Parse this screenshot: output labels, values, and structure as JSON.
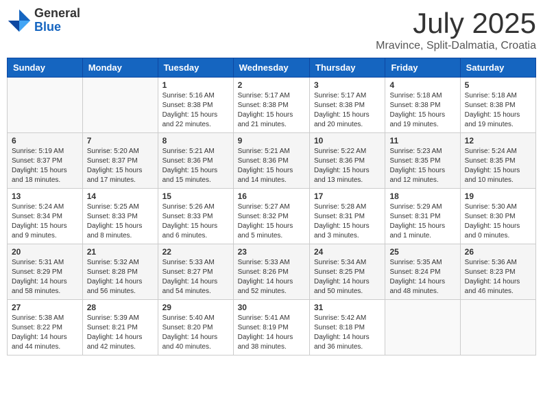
{
  "header": {
    "logo_general": "General",
    "logo_blue": "Blue",
    "month": "July 2025",
    "location": "Mravince, Split-Dalmatia, Croatia"
  },
  "weekdays": [
    "Sunday",
    "Monday",
    "Tuesday",
    "Wednesday",
    "Thursday",
    "Friday",
    "Saturday"
  ],
  "weeks": [
    [
      {
        "day": "",
        "info": ""
      },
      {
        "day": "",
        "info": ""
      },
      {
        "day": "1",
        "info": "Sunrise: 5:16 AM\nSunset: 8:38 PM\nDaylight: 15 hours\nand 22 minutes."
      },
      {
        "day": "2",
        "info": "Sunrise: 5:17 AM\nSunset: 8:38 PM\nDaylight: 15 hours\nand 21 minutes."
      },
      {
        "day": "3",
        "info": "Sunrise: 5:17 AM\nSunset: 8:38 PM\nDaylight: 15 hours\nand 20 minutes."
      },
      {
        "day": "4",
        "info": "Sunrise: 5:18 AM\nSunset: 8:38 PM\nDaylight: 15 hours\nand 19 minutes."
      },
      {
        "day": "5",
        "info": "Sunrise: 5:18 AM\nSunset: 8:38 PM\nDaylight: 15 hours\nand 19 minutes."
      }
    ],
    [
      {
        "day": "6",
        "info": "Sunrise: 5:19 AM\nSunset: 8:37 PM\nDaylight: 15 hours\nand 18 minutes."
      },
      {
        "day": "7",
        "info": "Sunrise: 5:20 AM\nSunset: 8:37 PM\nDaylight: 15 hours\nand 17 minutes."
      },
      {
        "day": "8",
        "info": "Sunrise: 5:21 AM\nSunset: 8:36 PM\nDaylight: 15 hours\nand 15 minutes."
      },
      {
        "day": "9",
        "info": "Sunrise: 5:21 AM\nSunset: 8:36 PM\nDaylight: 15 hours\nand 14 minutes."
      },
      {
        "day": "10",
        "info": "Sunrise: 5:22 AM\nSunset: 8:36 PM\nDaylight: 15 hours\nand 13 minutes."
      },
      {
        "day": "11",
        "info": "Sunrise: 5:23 AM\nSunset: 8:35 PM\nDaylight: 15 hours\nand 12 minutes."
      },
      {
        "day": "12",
        "info": "Sunrise: 5:24 AM\nSunset: 8:35 PM\nDaylight: 15 hours\nand 10 minutes."
      }
    ],
    [
      {
        "day": "13",
        "info": "Sunrise: 5:24 AM\nSunset: 8:34 PM\nDaylight: 15 hours\nand 9 minutes."
      },
      {
        "day": "14",
        "info": "Sunrise: 5:25 AM\nSunset: 8:33 PM\nDaylight: 15 hours\nand 8 minutes."
      },
      {
        "day": "15",
        "info": "Sunrise: 5:26 AM\nSunset: 8:33 PM\nDaylight: 15 hours\nand 6 minutes."
      },
      {
        "day": "16",
        "info": "Sunrise: 5:27 AM\nSunset: 8:32 PM\nDaylight: 15 hours\nand 5 minutes."
      },
      {
        "day": "17",
        "info": "Sunrise: 5:28 AM\nSunset: 8:31 PM\nDaylight: 15 hours\nand 3 minutes."
      },
      {
        "day": "18",
        "info": "Sunrise: 5:29 AM\nSunset: 8:31 PM\nDaylight: 15 hours\nand 1 minute."
      },
      {
        "day": "19",
        "info": "Sunrise: 5:30 AM\nSunset: 8:30 PM\nDaylight: 15 hours\nand 0 minutes."
      }
    ],
    [
      {
        "day": "20",
        "info": "Sunrise: 5:31 AM\nSunset: 8:29 PM\nDaylight: 14 hours\nand 58 minutes."
      },
      {
        "day": "21",
        "info": "Sunrise: 5:32 AM\nSunset: 8:28 PM\nDaylight: 14 hours\nand 56 minutes."
      },
      {
        "day": "22",
        "info": "Sunrise: 5:33 AM\nSunset: 8:27 PM\nDaylight: 14 hours\nand 54 minutes."
      },
      {
        "day": "23",
        "info": "Sunrise: 5:33 AM\nSunset: 8:26 PM\nDaylight: 14 hours\nand 52 minutes."
      },
      {
        "day": "24",
        "info": "Sunrise: 5:34 AM\nSunset: 8:25 PM\nDaylight: 14 hours\nand 50 minutes."
      },
      {
        "day": "25",
        "info": "Sunrise: 5:35 AM\nSunset: 8:24 PM\nDaylight: 14 hours\nand 48 minutes."
      },
      {
        "day": "26",
        "info": "Sunrise: 5:36 AM\nSunset: 8:23 PM\nDaylight: 14 hours\nand 46 minutes."
      }
    ],
    [
      {
        "day": "27",
        "info": "Sunrise: 5:38 AM\nSunset: 8:22 PM\nDaylight: 14 hours\nand 44 minutes."
      },
      {
        "day": "28",
        "info": "Sunrise: 5:39 AM\nSunset: 8:21 PM\nDaylight: 14 hours\nand 42 minutes."
      },
      {
        "day": "29",
        "info": "Sunrise: 5:40 AM\nSunset: 8:20 PM\nDaylight: 14 hours\nand 40 minutes."
      },
      {
        "day": "30",
        "info": "Sunrise: 5:41 AM\nSunset: 8:19 PM\nDaylight: 14 hours\nand 38 minutes."
      },
      {
        "day": "31",
        "info": "Sunrise: 5:42 AM\nSunset: 8:18 PM\nDaylight: 14 hours\nand 36 minutes."
      },
      {
        "day": "",
        "info": ""
      },
      {
        "day": "",
        "info": ""
      }
    ]
  ]
}
